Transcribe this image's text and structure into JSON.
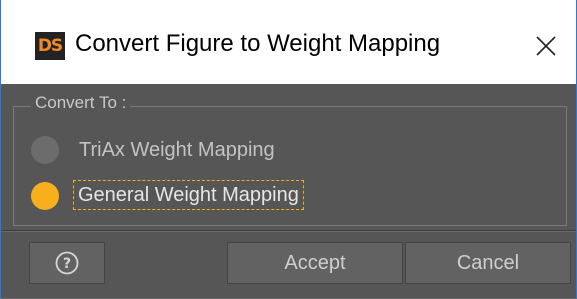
{
  "window": {
    "app_icon_text": "DS",
    "title": "Convert Figure to Weight Mapping",
    "close_icon": "close-icon"
  },
  "group": {
    "title": "Convert To :",
    "options": [
      {
        "label": "TriAx Weight Mapping",
        "selected": false
      },
      {
        "label": "General Weight Mapping",
        "selected": true
      }
    ]
  },
  "buttons": {
    "help_icon": "question-icon",
    "accept_label": "Accept",
    "cancel_label": "Cancel"
  },
  "colors": {
    "accent": "#f7b01c",
    "panel": "#565656",
    "title_border": "#2b79d8"
  }
}
